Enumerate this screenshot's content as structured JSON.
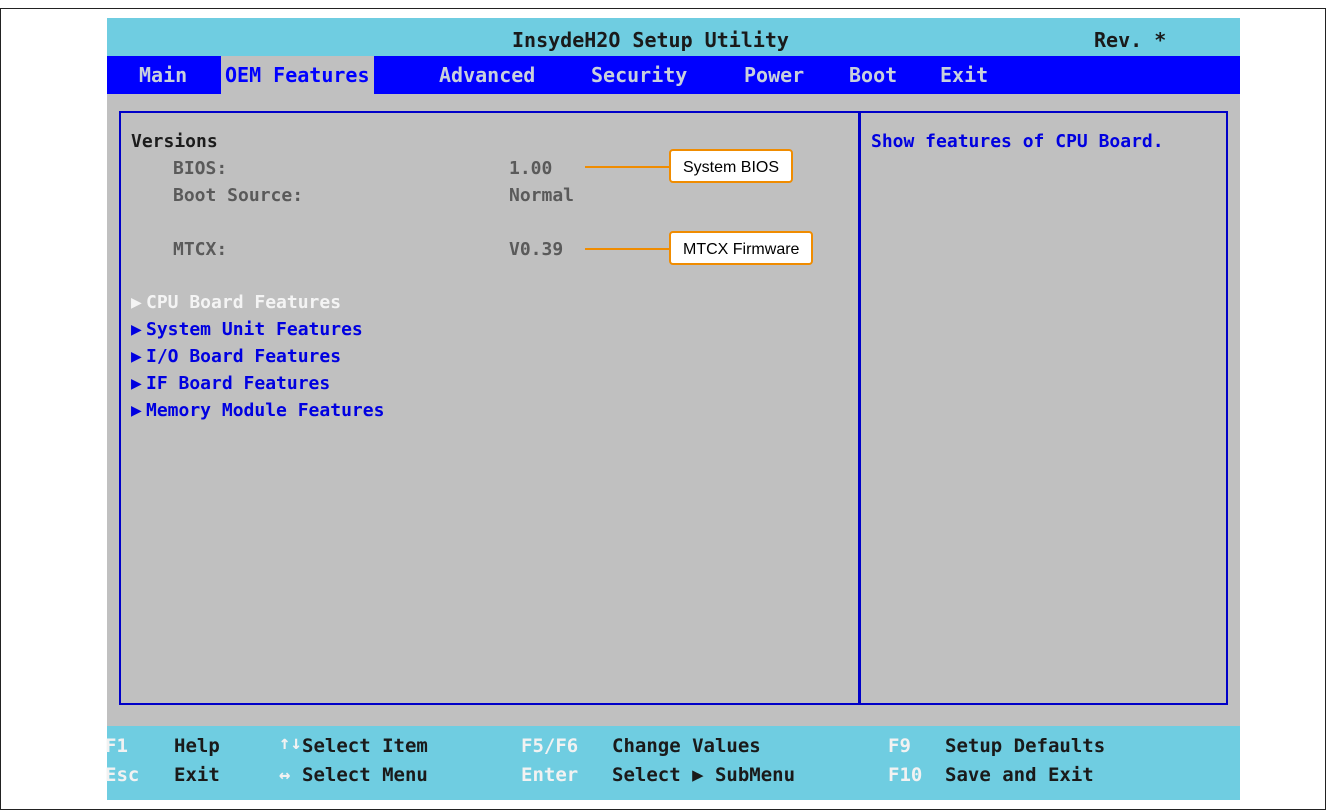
{
  "header": {
    "title": "InsydeH2O Setup Utility",
    "rev": "Rev. *"
  },
  "menu": {
    "tabs": [
      {
        "label": "Main",
        "active": false
      },
      {
        "label": "OEM Features",
        "active": true
      },
      {
        "label": "Advanced",
        "active": false
      },
      {
        "label": "Security",
        "active": false
      },
      {
        "label": "Power",
        "active": false
      },
      {
        "label": "Boot",
        "active": false
      },
      {
        "label": "Exit",
        "active": false
      }
    ]
  },
  "versions": {
    "heading": "Versions",
    "bios_label": "BIOS:",
    "bios_value": "1.00",
    "boot_source_label": "Boot Source:",
    "boot_source_value": "Normal",
    "mtcx_label": "MTCX:",
    "mtcx_value": "V0.39"
  },
  "submenus": [
    {
      "label": "CPU Board Features",
      "selected": true
    },
    {
      "label": "System Unit Features",
      "selected": false
    },
    {
      "label": "I/O Board Features",
      "selected": false
    },
    {
      "label": "IF Board Features",
      "selected": false
    },
    {
      "label": "Memory Module Features",
      "selected": false
    }
  ],
  "help_text": "Show features of CPU Board.",
  "callouts": {
    "bios": "System BIOS",
    "mtcx": "MTCX Firmware"
  },
  "footer": {
    "row1": [
      {
        "key": "F1",
        "label": "Help"
      },
      {
        "key": "↑↓",
        "label": "Select Item"
      },
      {
        "key": "F5/F6",
        "label": "Change Values"
      },
      {
        "key": "F9",
        "label": "Setup Defaults"
      }
    ],
    "row2": [
      {
        "key": "Esc",
        "label": "Exit"
      },
      {
        "key": "↔",
        "label": "Select Menu"
      },
      {
        "key": "Enter",
        "label": "Select ▶ SubMenu"
      },
      {
        "key": "F10",
        "label": "Save and Exit"
      }
    ]
  },
  "colors": {
    "menubar": "#0000ff",
    "titlebar": "#6fcde1",
    "background": "#c0c0c0",
    "callout_border": "#f08c00"
  }
}
